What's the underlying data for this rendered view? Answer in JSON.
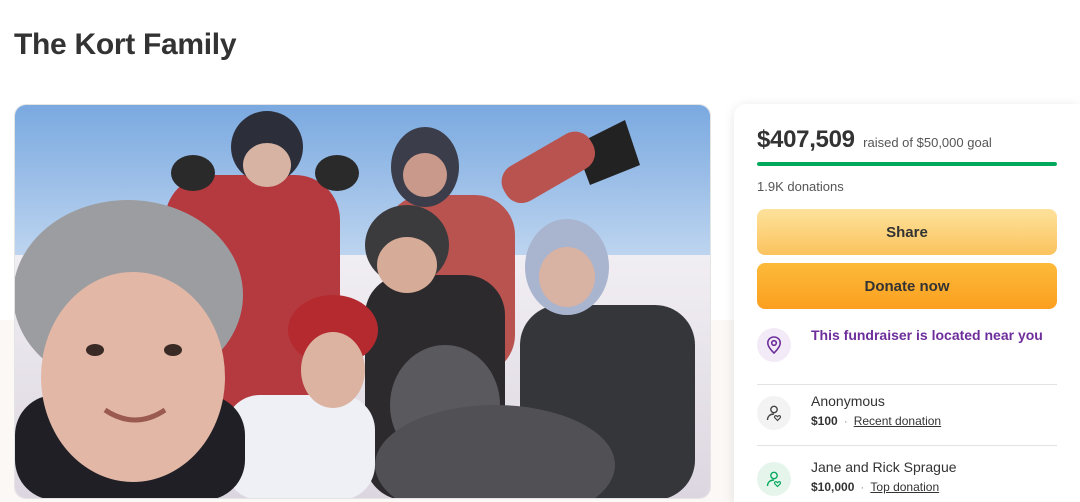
{
  "page": {
    "title": "The Kort Family"
  },
  "photo": {
    "description_icon": "family-photo"
  },
  "summary": {
    "raised_amount": "$407,509",
    "raised_text": "raised of $50,000 goal",
    "progress_fraction": 1.0,
    "donations_count": "1.9K donations"
  },
  "actions": {
    "share_label": "Share",
    "donate_label": "Donate now"
  },
  "location": {
    "text": "This fundraiser is located near you",
    "icon": "location-pin-icon"
  },
  "donors": [
    {
      "name": "Anonymous",
      "amount": "$100",
      "tag": "Recent donation",
      "icon": "donor-heart-icon"
    },
    {
      "name": "Jane and Rick Sprague",
      "amount": "$10,000",
      "tag": "Top donation",
      "icon": "donor-heart-icon"
    }
  ],
  "colors": {
    "progress": "#02a95c",
    "location_text": "#6d2e9b",
    "share_button": "#fbc35e",
    "donate_button": "#fb9f20"
  }
}
